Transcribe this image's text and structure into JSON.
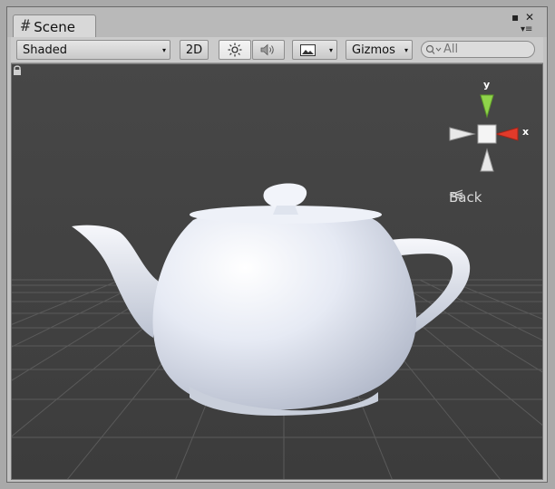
{
  "window": {
    "tab": {
      "icon": "grid-icon",
      "label": "Scene"
    },
    "controls": {
      "maximize": "▪",
      "close": "✕",
      "menu": "▾≡"
    }
  },
  "toolbar": {
    "draw_mode": {
      "value": "Shaded",
      "arrow": "▾"
    },
    "mode_2d": "2D",
    "lighting_icon": "sun-icon",
    "audio_icon": "speaker-icon",
    "effects_icon": "image-icon",
    "effects_arrow": "▾",
    "gizmos": {
      "label": "Gizmos",
      "arrow": "▾"
    },
    "search": {
      "placeholder": "All",
      "icon": "search-icon"
    }
  },
  "scene_gizmo": {
    "y_label": "y",
    "x_label": "x",
    "back_label": "Back",
    "back_icon": "perspective-icon",
    "lock_icon": "lock-icon",
    "colors": {
      "y": "#8fd44a",
      "x": "#e23a2a",
      "neutral": "#e8e8e8"
    }
  },
  "scene": {
    "object_icon": "teapot",
    "background": "#474747",
    "grid_color": "#5a5a5a"
  }
}
